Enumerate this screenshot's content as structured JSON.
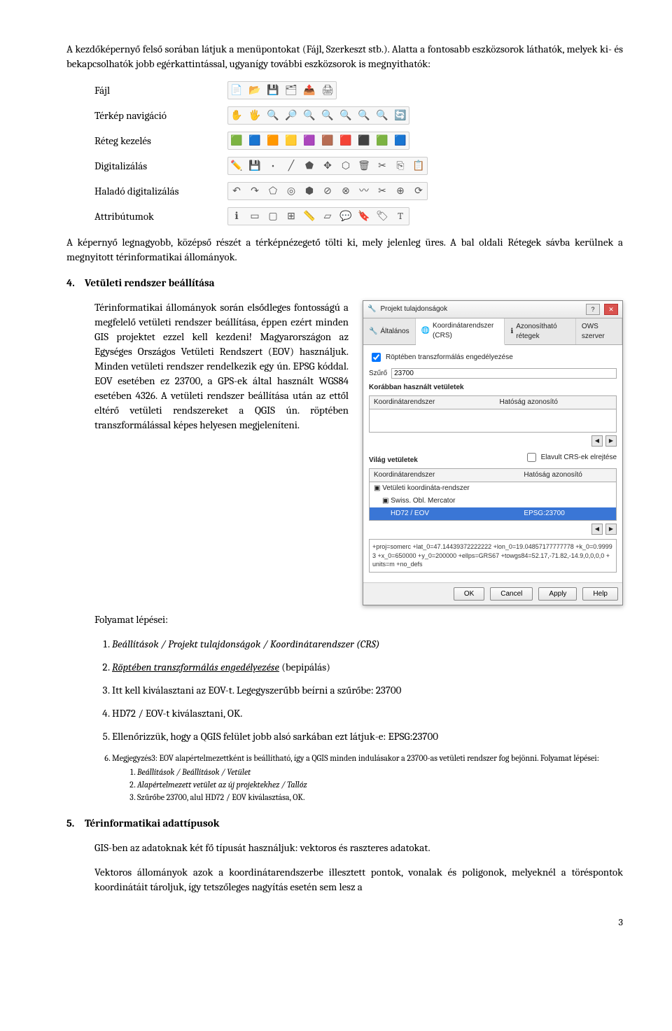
{
  "intro_para": "A kezdőképernyő felső sorában látjuk a menüpontokat (Fájl, Szerkeszt stb.). Alatta a fontosabb eszközsorok láthatók, melyek ki- és bekapcsolhatók jobb egérkattintással, ugyanígy további eszközsorok is megnyithatók:",
  "toolrows": {
    "r1": "Fájl",
    "r2": "Térkép navigáció",
    "r3": "Réteg kezelés",
    "r4": "Digitalizálás",
    "r5": "Haladó digitalizálás",
    "r6": "Attribútumok"
  },
  "after_tools": "A képernyő legnagyobb, középső részét a térképnézegető tölti ki, mely jelenleg üres. A bal oldali Rétegek sávba kerülnek a megnyitott térinformatikai állományok.",
  "sec4_num": "4.",
  "sec4_title": "Vetületi rendszer beállítása",
  "sec4_para": "Térinformatikai állományok során elsődleges fontosságú a megfelelő vetületi rendszer beállítása, éppen ezért minden GIS projektet ezzel kell kezdeni! Magyarországon az Egységes Országos Vetületi Rendszert (EOV) használjuk. Minden vetületi rendszer rendelkezik egy ún. EPSG kóddal. EOV esetében ez 23700, a GPS-ek által használt WGS84 esetében 4326. A vetületi rendszer beállítása után az ettől eltérő vetületi rendszereket a QGIS ún. röptében transzformálással képes helyesen megjeleníteni.",
  "steps_lead": "Folyamat lépései:",
  "steps": {
    "s1": "Beállítások / Projekt tulajdonságok / Koordinátarendszer (CRS)",
    "s2a": "Röptében transzformálás engedélyezése",
    "s2b": " (bepipálás)",
    "s3": "Itt kell kiválasztani az EOV-t. Legegyszerűbb beírni a szűrőbe: 23700",
    "s4": "HD72 / EOV-t kiválasztani, OK.",
    "s5": "Ellenőrizzük, hogy a QGIS felület jobb alsó sarkában ezt látjuk-e: EPSG:23700"
  },
  "note6_lead": "Megjegyzés3: EOV alapértelmezettként is beállítható, így a QGIS minden indulásakor a 23700-as vetületi rendszer fog bejönni. Folyamat lépései:",
  "note6": {
    "n1": "Beállítások / Beállítások / Vetület",
    "n2": "Alapértelmezett vetület az új projektekhez / Tallóz",
    "n3": "Szűrőbe 23700, alul HD72 / EOV kiválasztása, OK."
  },
  "sec5_num": "5.",
  "sec5_title": "Térinformatikai adattípusok",
  "sec5_p1": "GIS-ben az adatoknak két fő típusát használjuk: vektoros és raszteres adatokat.",
  "sec5_p2": "Vektoros állományok azok a koordinátarendszerbe illesztett pontok, vonalak és poligonok, melyeknél a töréspontok koordinátáit tároljuk, így tetszőleges nagyítás esetén sem lesz a",
  "pagenum": "3",
  "dialog": {
    "title": "Projekt tulajdonságok",
    "tabs": {
      "t1": "Általános",
      "t2": "Koordinátarendszer (CRS)",
      "t3": "Azonosítható rétegek",
      "t4": "OWS szerver"
    },
    "chk_onfly": "Röptében transzformálás engedélyezése",
    "filter_label": "Szűrő",
    "filter_value": "23700",
    "recent_label": "Korábban használt vetületek",
    "col_crs": "Koordinátarendszer",
    "col_auth": "Hatóság azonosító",
    "world_label": "Világ vetületek",
    "chk_hide": "Elavult CRS-ek elrejtése",
    "tree1": "Vetületi koordináta-rendszer",
    "tree2": "Swiss. Obl. Mercator",
    "tree_sel": "HD72 / EOV",
    "tree_sel_auth": "EPSG:23700",
    "proj": "+proj=somerc +lat_0=47.14439372222222 +lon_0=19.04857177777778 +k_0=0.99993 +x_0=650000 +y_0=200000 +ellps=GRS67 +towgs84=52.17,-71.82,-14.9,0,0,0,0 +units=m +no_defs",
    "btn_ok": "OK",
    "btn_cancel": "Cancel",
    "btn_apply": "Apply",
    "btn_help": "Help"
  }
}
